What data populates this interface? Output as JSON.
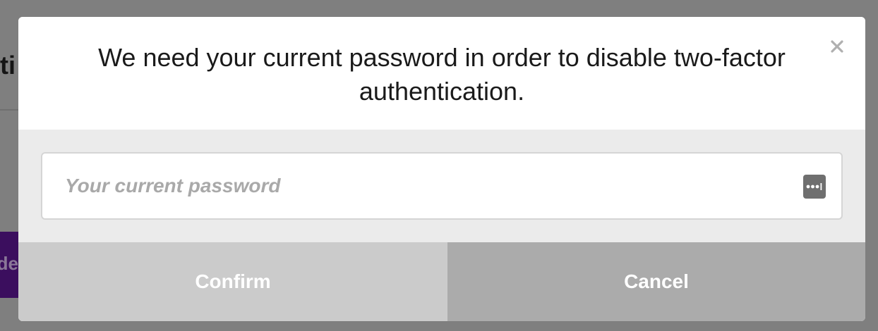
{
  "modal": {
    "title": "We need your current password in order to disable two-factor authentication.",
    "close_icon": "close-icon",
    "password_field": {
      "placeholder": "Your current password",
      "value": "",
      "manager_icon": "password-manager-icon"
    },
    "confirm_label": "Confirm",
    "cancel_label": "Cancel"
  },
  "background_page": {
    "heading_fragment": "ti",
    "button_fragment": "de"
  },
  "colors": {
    "overlay": "#7f7f7f",
    "body_band": "#ebebeb",
    "confirm_bg": "#cbcbcb",
    "cancel_bg": "#ababab",
    "bg_button_accent": "#3b0e5e"
  }
}
